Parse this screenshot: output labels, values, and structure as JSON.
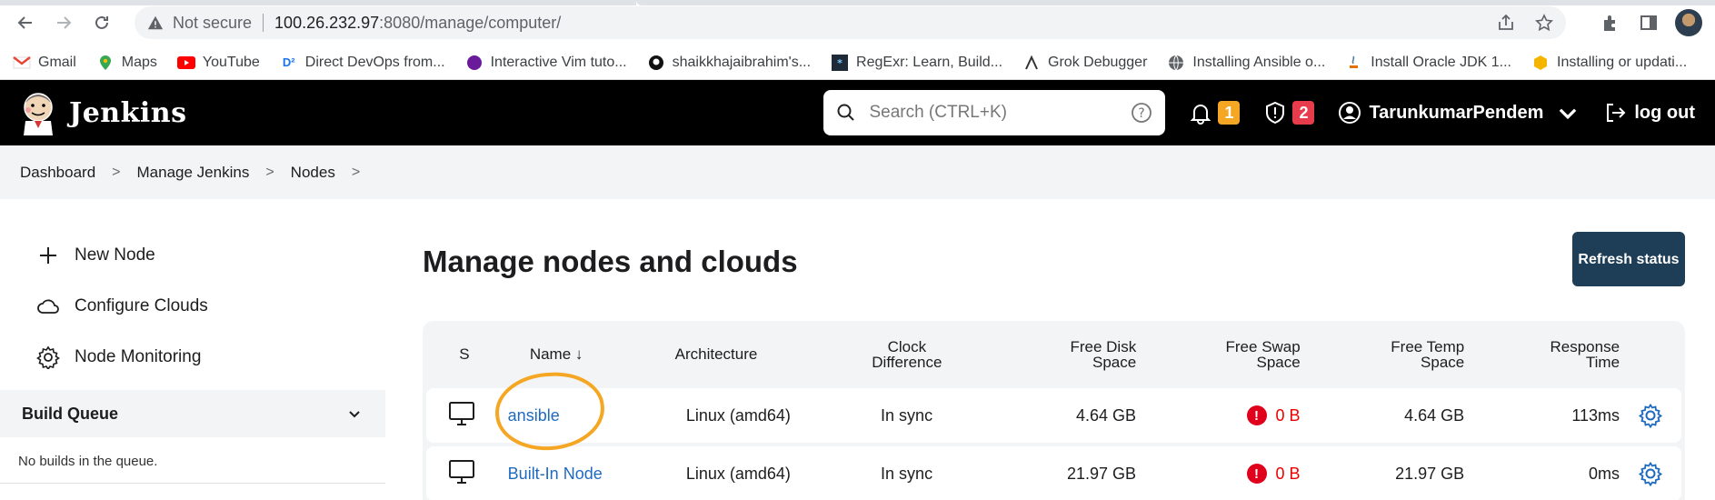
{
  "browser": {
    "secure_label": "Not secure",
    "url_host": "100.26.232.97",
    "url_path": ":8080/manage/computer/",
    "bookmarks": [
      {
        "label": "Gmail",
        "icon": "gmail-icon"
      },
      {
        "label": "Maps",
        "icon": "maps-icon"
      },
      {
        "label": "YouTube",
        "icon": "youtube-icon"
      },
      {
        "label": "Direct DevOps from...",
        "icon": "devops-icon"
      },
      {
        "label": "Interactive Vim tuto...",
        "icon": "vim-icon"
      },
      {
        "label": "shaikkhajaibrahim's...",
        "icon": "github-icon"
      },
      {
        "label": "RegExr: Learn, Build...",
        "icon": "regexr-icon"
      },
      {
        "label": "Grok Debugger",
        "icon": "grok-icon"
      },
      {
        "label": "Installing Ansible o...",
        "icon": "globe-icon"
      },
      {
        "label": "Install Oracle JDK 1...",
        "icon": "java-icon"
      },
      {
        "label": "Installing or updati...",
        "icon": "aws-icon"
      }
    ]
  },
  "header": {
    "title": "Jenkins",
    "search_placeholder": "Search (CTRL+K)",
    "notifications_count": "1",
    "security_count": "2",
    "user_name": "TarunkumarPendem",
    "logout_label": "log out"
  },
  "breadcrumb": [
    "Dashboard",
    "Manage Jenkins",
    "Nodes"
  ],
  "sidebar": {
    "tasks": [
      {
        "label": "New Node",
        "icon": "plus-icon"
      },
      {
        "label": "Configure Clouds",
        "icon": "cloud-icon"
      },
      {
        "label": "Node Monitoring",
        "icon": "gear-icon"
      }
    ],
    "build_queue_title": "Build Queue",
    "build_queue_empty": "No builds in the queue."
  },
  "main": {
    "title": "Manage nodes and clouds",
    "refresh_label": "Refresh status",
    "columns": {
      "s": "S",
      "name": "Name",
      "name_sort": "↓",
      "arch": "Architecture",
      "clock_1": "Clock",
      "clock_2": "Difference",
      "disk_1": "Free Disk",
      "disk_2": "Space",
      "swap_1": "Free Swap",
      "swap_2": "Space",
      "temp_1": "Free Temp",
      "temp_2": "Space",
      "resp_1": "Response",
      "resp_2": "Time"
    },
    "nodes": [
      {
        "name": "ansible",
        "arch": "Linux (amd64)",
        "clock": "In sync",
        "disk": "4.64 GB",
        "swap": "0 B",
        "temp": "4.64 GB",
        "resp": "113ms"
      },
      {
        "name": "Built-In Node",
        "arch": "Linux (amd64)",
        "clock": "In sync",
        "disk": "21.97 GB",
        "swap": "0 B",
        "temp": "21.97 GB",
        "resp": "0ms"
      }
    ]
  },
  "colors": {
    "header_bg": "#000000",
    "link": "#1e6ac0",
    "refresh_bg": "#1e3d56",
    "annotation": "#f5a623",
    "error": "#e0001b"
  }
}
